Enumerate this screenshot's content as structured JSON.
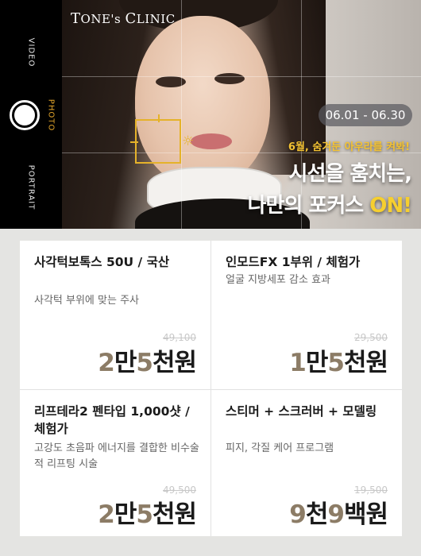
{
  "camera": {
    "modes": [
      "VIDEO",
      "PHOTO",
      "PORTRAIT"
    ],
    "active_mode": "PHOTO"
  },
  "brand": {
    "prefix_big": "T",
    "prefix": "ONE",
    "apostrophe": "'s ",
    "suffix_big": "C",
    "suffix": "LINIC"
  },
  "banner": {
    "date_range": "06.01 - 06.30",
    "tagline": "6월, 숨겨둔 아우라를 켜봐!",
    "headline_1": "시선을 훔치는,",
    "headline_2_a": "나만의 포커스 ",
    "headline_2_b": "ON!"
  },
  "accent_colors": {
    "gold": "#e5b22a",
    "price_number": "#8c7c66",
    "active_mode": "#e5a72b"
  },
  "products": [
    {
      "title": "사각턱보톡스 50U / 국산",
      "description": "사각턱 부위에 맞는 주사",
      "original_price": "49,100",
      "price_parts": [
        "2",
        "만",
        "5",
        "천원"
      ]
    },
    {
      "title": "인모드FX 1부위 / 체험가",
      "description": "얼굴 지방세포 감소 효과",
      "original_price": "29,500",
      "price_parts": [
        "1",
        "만",
        "5",
        "천원"
      ]
    },
    {
      "title": "리프테라2 펜타입 1,000샷 / 체험가",
      "description": "고강도 초음파 에너지를 결합한 비수술적 리프팅 시술",
      "original_price": "49,500",
      "price_parts": [
        "2",
        "만",
        "5",
        "천원"
      ]
    },
    {
      "title": "스티머 + 스크러버 + 모델링",
      "description": "피지, 각질 케어 프로그램",
      "original_price": "19,500",
      "price_parts": [
        "9",
        "천",
        "9",
        "백원"
      ]
    }
  ]
}
